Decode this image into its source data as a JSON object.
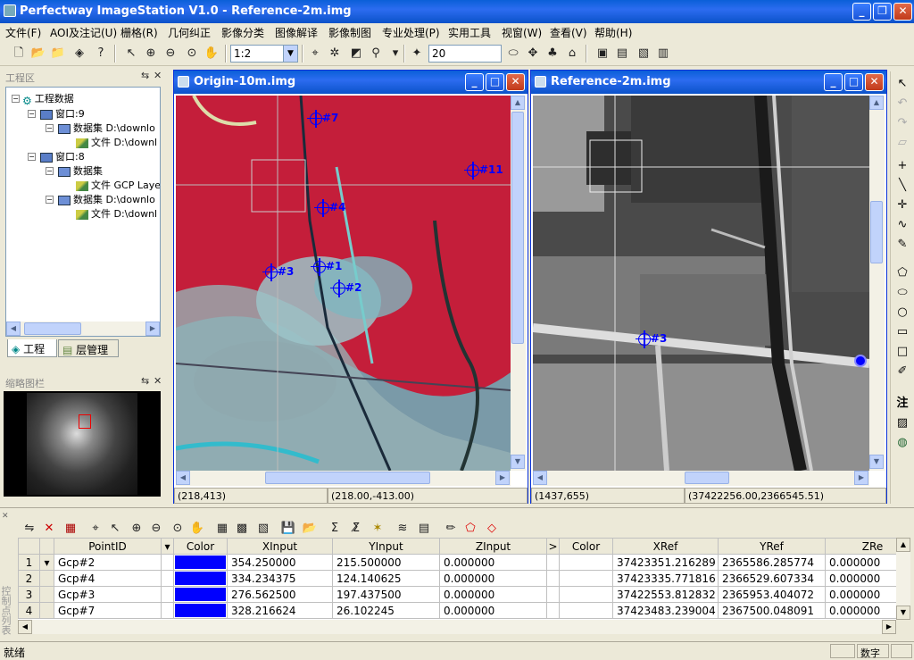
{
  "app": {
    "title": "Perfectway ImageStation V1.0 - Reference-2m.img"
  },
  "menu": [
    "文件(F)",
    "AOI及注记(U)",
    "栅格(R)",
    "几何纠正",
    "影像分类",
    "图像解译",
    "影像制图",
    "专业处理(P)",
    "实用工具",
    "视窗(W)",
    "查看(V)",
    "帮助(H)"
  ],
  "toolbar": {
    "scale": "1:2",
    "threshold": "20"
  },
  "project_panel": {
    "title": "工程区",
    "tree": [
      {
        "label": "工程数据"
      },
      {
        "label": "窗口:9"
      },
      {
        "label": "数据集 D:\\downlo"
      },
      {
        "label": "文件 D:\\downl"
      },
      {
        "label": "窗口:8"
      },
      {
        "label": "数据集"
      },
      {
        "label": "文件 GCP Laye"
      },
      {
        "label": "数据集 D:\\downlo"
      },
      {
        "label": "文件 D:\\downl"
      }
    ],
    "tabs": [
      "工程",
      "层管理"
    ]
  },
  "thumb_panel": {
    "title": "缩略图栏"
  },
  "left_window": {
    "title": "Origin-10m.img",
    "status_pixel": "(218,413)",
    "status_coord": "(218.00,-413.00)",
    "gcps": [
      "#7",
      "#11",
      "#4",
      "#1",
      "#3",
      "#2"
    ]
  },
  "right_window": {
    "title": "Reference-2m.img",
    "status_pixel": "(1437,655)",
    "status_coord": "(37422256.00,2366545.51)",
    "gcps": [
      "#3"
    ]
  },
  "gcp_table": {
    "side_label": "控制点列表",
    "columns": [
      "PointID",
      "Color",
      "XInput",
      "YInput",
      "ZInput",
      ">",
      "Color",
      "XRef",
      "YRef",
      "ZRe"
    ],
    "rows": [
      {
        "num": "1",
        "id": "Gcp#2",
        "color": "#0000ff",
        "x": "354.250000",
        "y": "215.500000",
        "z": "0.000000",
        "xref": "37423351.216289",
        "yref": "2365586.285774",
        "zref": "0.000000"
      },
      {
        "num": "2",
        "id": "Gcp#4",
        "color": "#0000ff",
        "x": "334.234375",
        "y": "124.140625",
        "z": "0.000000",
        "xref": "37423335.771816",
        "yref": "2366529.607334",
        "zref": "0.000000"
      },
      {
        "num": "3",
        "id": "Gcp#3",
        "color": "#0000ff",
        "x": "276.562500",
        "y": "197.437500",
        "z": "0.000000",
        "xref": "37422553.812832",
        "yref": "2365953.404072",
        "zref": "0.000000"
      },
      {
        "num": "4",
        "id": "Gcp#7",
        "color": "#0000ff",
        "x": "328.216624",
        "y": "26.102245",
        "z": "0.000000",
        "xref": "37423483.239004",
        "yref": "2367500.048091",
        "zref": "0.000000"
      }
    ]
  },
  "statusbar": {
    "left": "就绪",
    "mode": "数字"
  }
}
